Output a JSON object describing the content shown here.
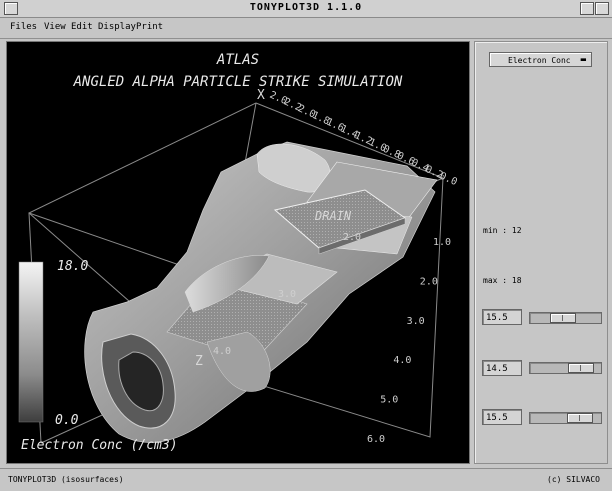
{
  "window": {
    "title": "TONYPLOT3D 1.1.0"
  },
  "menubar": {
    "items": [
      "Files",
      "View",
      "Edit",
      "Display",
      "Print"
    ]
  },
  "plot": {
    "title_line1": "ATLAS",
    "title_line2": "ANGLED ALPHA PARTICLE STRIKE SIMULATION",
    "region_label": "DRAIN",
    "x_axis_name": "X",
    "z_axis_name": "Z",
    "x_ticks": [
      "2.0",
      "2.2",
      "2.0",
      "1.8",
      "1.6",
      "1.4",
      "1.2",
      "1.0",
      "0.8",
      "0.6",
      "0.4",
      "0.2",
      "0.0"
    ],
    "y_ticks": [
      "1.0",
      "2.0",
      "3.0",
      "4.0",
      "5.0",
      "6.0"
    ],
    "z_ticks": [
      "2.0",
      "3.0",
      "4.0"
    ],
    "legend_max": "18.0",
    "legend_min": "0.0",
    "legend_label": "Electron Conc (/cm3)",
    "colors": {
      "background": "#000000",
      "surface": "#9a9a9a",
      "axes": "#bdbdbd",
      "text": "#e6e6e6"
    }
  },
  "sidepanel": {
    "quantity_select": "Electron Conc",
    "min_label": "min : 12",
    "max_label": "max : 18",
    "isosurfaces": [
      {
        "value": "15.5",
        "level": 0.45
      },
      {
        "value": "14.5",
        "level": 0.85
      },
      {
        "value": "15.5",
        "level": 0.82
      }
    ]
  },
  "statusbar": {
    "left": "TONYPLOT3D (isosurfaces)",
    "right": "(c) SILVACO"
  }
}
